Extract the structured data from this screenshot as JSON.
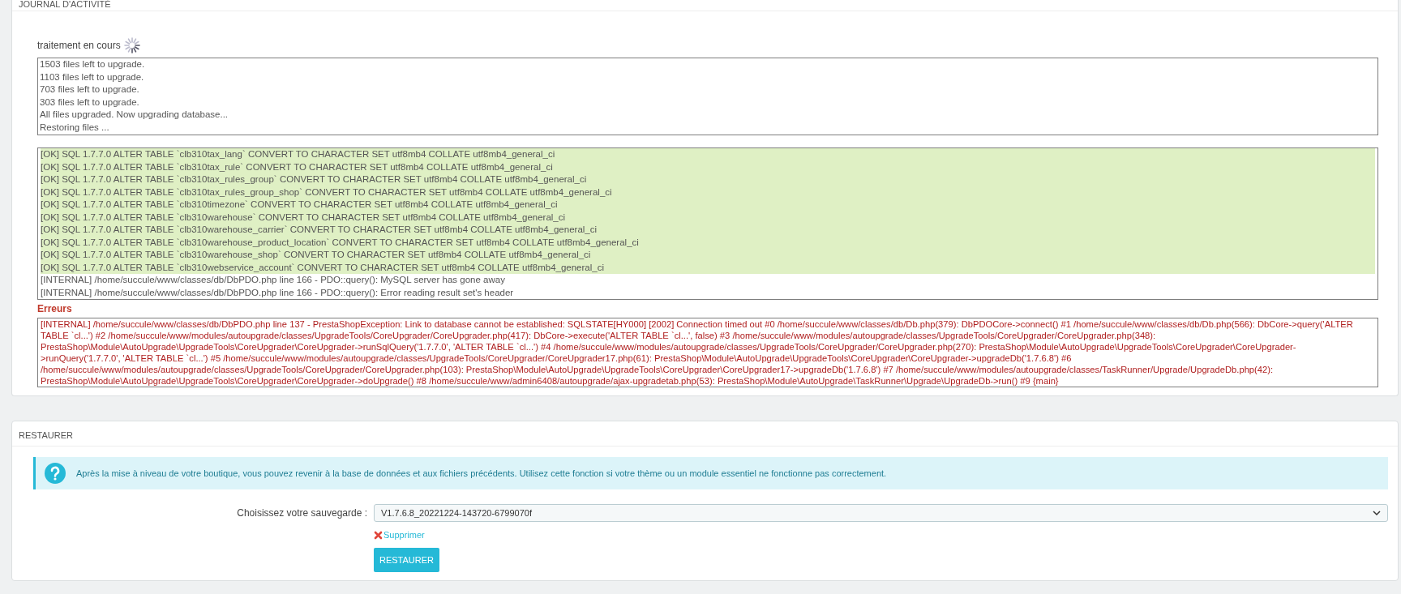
{
  "activity_panel": {
    "title": "JOURNAL D'ACTIVITÉ",
    "status": "traitement en cours",
    "progress_log": [
      "1503 files left to upgrade.",
      "1103 files left to upgrade.",
      "703 files left to upgrade.",
      "303 files left to upgrade.",
      "All files upgraded. Now upgrading database...",
      "Restoring files ..."
    ],
    "sql_log": [
      {
        "kind": "ok",
        "text": "[OK] SQL 1.7.7.0 ALTER TABLE `clb310tax_lang` CONVERT TO CHARACTER SET utf8mb4 COLLATE utf8mb4_general_ci"
      },
      {
        "kind": "ok",
        "text": "[OK] SQL 1.7.7.0 ALTER TABLE `clb310tax_rule` CONVERT TO CHARACTER SET utf8mb4 COLLATE utf8mb4_general_ci"
      },
      {
        "kind": "ok",
        "text": "[OK] SQL 1.7.7.0 ALTER TABLE `clb310tax_rules_group` CONVERT TO CHARACTER SET utf8mb4 COLLATE utf8mb4_general_ci"
      },
      {
        "kind": "ok",
        "text": "[OK] SQL 1.7.7.0 ALTER TABLE `clb310tax_rules_group_shop` CONVERT TO CHARACTER SET utf8mb4 COLLATE utf8mb4_general_ci"
      },
      {
        "kind": "ok",
        "text": "[OK] SQL 1.7.7.0 ALTER TABLE `clb310timezone` CONVERT TO CHARACTER SET utf8mb4 COLLATE utf8mb4_general_ci"
      },
      {
        "kind": "ok",
        "text": "[OK] SQL 1.7.7.0 ALTER TABLE `clb310warehouse` CONVERT TO CHARACTER SET utf8mb4 COLLATE utf8mb4_general_ci"
      },
      {
        "kind": "ok",
        "text": "[OK] SQL 1.7.7.0 ALTER TABLE `clb310warehouse_carrier` CONVERT TO CHARACTER SET utf8mb4 COLLATE utf8mb4_general_ci"
      },
      {
        "kind": "ok",
        "text": "[OK] SQL 1.7.7.0 ALTER TABLE `clb310warehouse_product_location` CONVERT TO CHARACTER SET utf8mb4 COLLATE utf8mb4_general_ci"
      },
      {
        "kind": "ok",
        "text": "[OK] SQL 1.7.7.0 ALTER TABLE `clb310warehouse_shop` CONVERT TO CHARACTER SET utf8mb4 COLLATE utf8mb4_general_ci"
      },
      {
        "kind": "ok",
        "text": "[OK] SQL 1.7.7.0 ALTER TABLE `clb310webservice_account` CONVERT TO CHARACTER SET utf8mb4 COLLATE utf8mb4_general_ci"
      },
      {
        "kind": "internal",
        "text": "[INTERNAL] /home/succule/www/classes/db/DbPDO.php line 166 - PDO::query(): MySQL server has gone away"
      },
      {
        "kind": "internal",
        "text": "[INTERNAL] /home/succule/www/classes/db/DbPDO.php line 166 - PDO::query(): Error reading result set's header"
      }
    ],
    "errors_label": "Erreurs",
    "errors_text": "[INTERNAL] /home/succule/www/classes/db/DbPDO.php line 137 - PrestaShopException: Link to database cannot be established: SQLSTATE[HY000] [2002] Connection timed out #0 /home/succule/www/classes/db/Db.php(379): DbPDOCore->connect() #1 /home/succule/www/classes/db/Db.php(566): DbCore->query('ALTER TABLE `cl...') #2 /home/succule/www/modules/autoupgrade/classes/UpgradeTools/CoreUpgrader/CoreUpgrader.php(417): DbCore->execute('ALTER TABLE `cl...', false) #3 /home/succule/www/modules/autoupgrade/classes/UpgradeTools/CoreUpgrader/CoreUpgrader.php(348): PrestaShop\\Module\\AutoUpgrade\\UpgradeTools\\CoreUpgrader\\CoreUpgrader->runSqlQuery('1.7.7.0', 'ALTER TABLE `cl...') #4 /home/succule/www/modules/autoupgrade/classes/UpgradeTools/CoreUpgrader/CoreUpgrader.php(270): PrestaShop\\Module\\AutoUpgrade\\UpgradeTools\\CoreUpgrader\\CoreUpgrader->runQuery('1.7.7.0', 'ALTER TABLE `cl...') #5 /home/succule/www/modules/autoupgrade/classes/UpgradeTools/CoreUpgrader/CoreUpgrader17.php(61): PrestaShop\\Module\\AutoUpgrade\\UpgradeTools\\CoreUpgrader\\CoreUpgrader->upgradeDb('1.7.6.8') #6 /home/succule/www/modules/autoupgrade/classes/UpgradeTools/CoreUpgrader/CoreUpgrader.php(103): PrestaShop\\Module\\AutoUpgrade\\UpgradeTools\\CoreUpgrader\\CoreUpgrader17->upgradeDb('1.7.6.8') #7 /home/succule/www/modules/autoupgrade/classes/TaskRunner/Upgrade/UpgradeDb.php(42): PrestaShop\\Module\\AutoUpgrade\\UpgradeTools\\CoreUpgrader\\CoreUpgrader->doUpgrade() #8 /home/succule/www/admin6408/autoupgrade/ajax-upgradetab.php(53): PrestaShop\\Module\\AutoUpgrade\\TaskRunner\\Upgrade\\UpgradeDb->run() #9 {main}"
  },
  "restore_panel": {
    "title": "RESTAURER",
    "info": "Après la mise à niveau de votre boutique, vous pouvez revenir à la base de données et aux fichiers précédents. Utilisez cette fonction si votre thème ou un module essentiel ne fonctionne pas correctement.",
    "backup_label": "Choisissez votre sauvegarde :",
    "backup_value": "V1.7.6.8_20221224-143720-6799070f",
    "delete_link": "Supprimer",
    "restore_button": "RESTAURER"
  }
}
